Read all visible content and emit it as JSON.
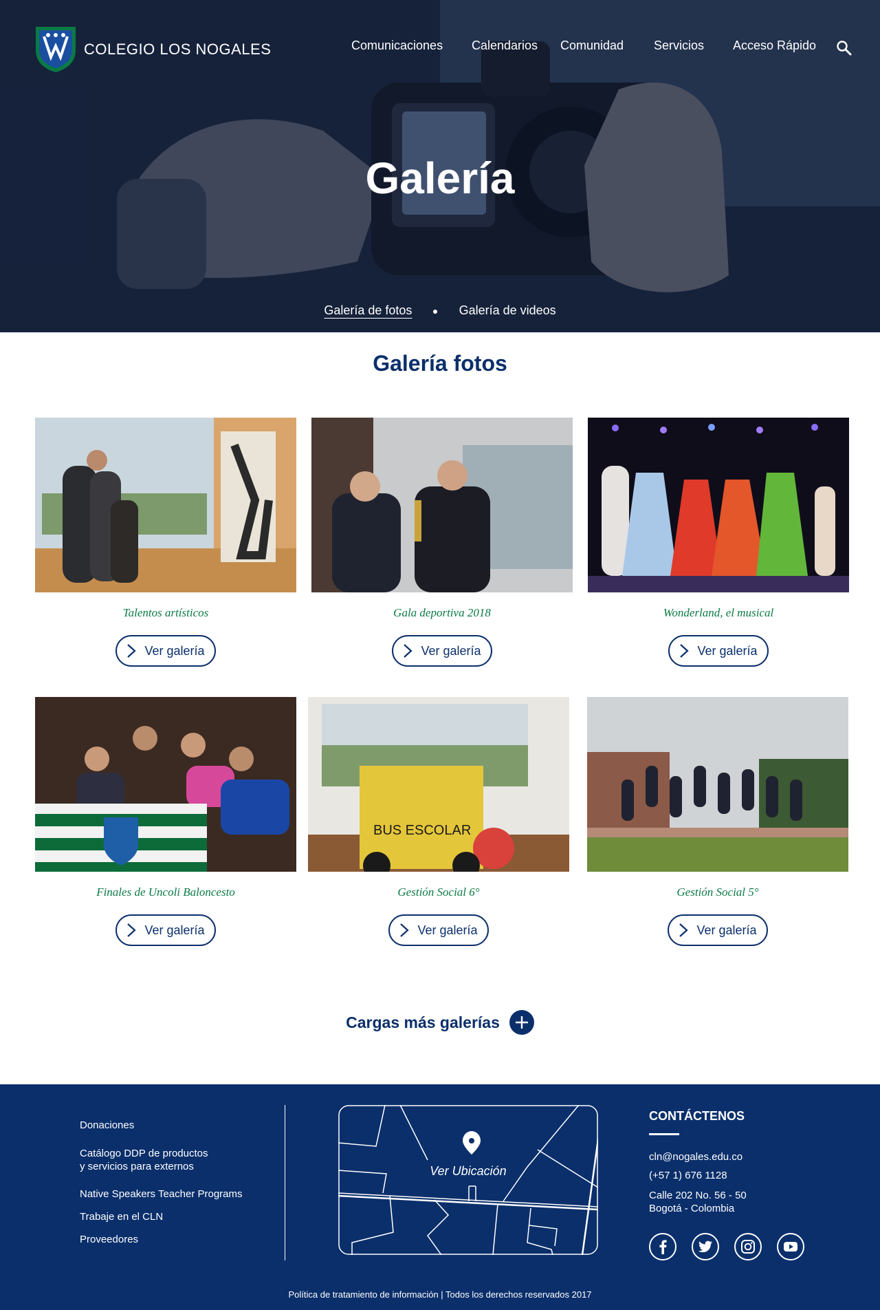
{
  "header": {
    "school_name": "COLEGIO LOS NOGALES",
    "nav": [
      "Comunicaciones",
      "Calendarios",
      "Comunidad",
      "Servicios",
      "Acceso Rápido"
    ],
    "search_icon": "search-icon"
  },
  "hero": {
    "title": "Galería",
    "tabs": [
      {
        "label": "Galería de fotos",
        "active": true
      },
      {
        "label": "Galería de videos",
        "active": false
      }
    ]
  },
  "gallery": {
    "title": "Galería fotos",
    "button_label": "Ver galería",
    "items": [
      {
        "caption": "Talentos artísticos"
      },
      {
        "caption": "Gala deportiva 2018"
      },
      {
        "caption": "Wonderland, el musical"
      },
      {
        "caption": "Finales de Uncoli Baloncesto"
      },
      {
        "caption": "Gestión Social 6°"
      },
      {
        "caption": "Gestión Social 5°"
      }
    ],
    "load_more": "Cargas más galerías"
  },
  "footer": {
    "links": [
      "Donaciones",
      "Catálogo DDP de productos\ny servicios para externos",
      "Native Speakers Teacher Programs",
      "Trabaje en el CLN",
      "Proveedores"
    ],
    "map_label": "Ver Ubicación",
    "contact_title": "CONTÁCTENOS",
    "email": "cln@nogales.edu.co",
    "phone": "(+57 1) 676 1128",
    "address": "Calle 202 No. 56 - 50\nBogotá - Colombia",
    "socials": [
      "facebook-icon",
      "twitter-icon",
      "instagram-icon",
      "youtube-icon"
    ],
    "legal": "Política de tratamiento de información | Todos los derechos reservados 2017"
  },
  "colors": {
    "primary": "#0b2f6b",
    "caption_green": "#0a7a44",
    "white": "#ffffff"
  }
}
